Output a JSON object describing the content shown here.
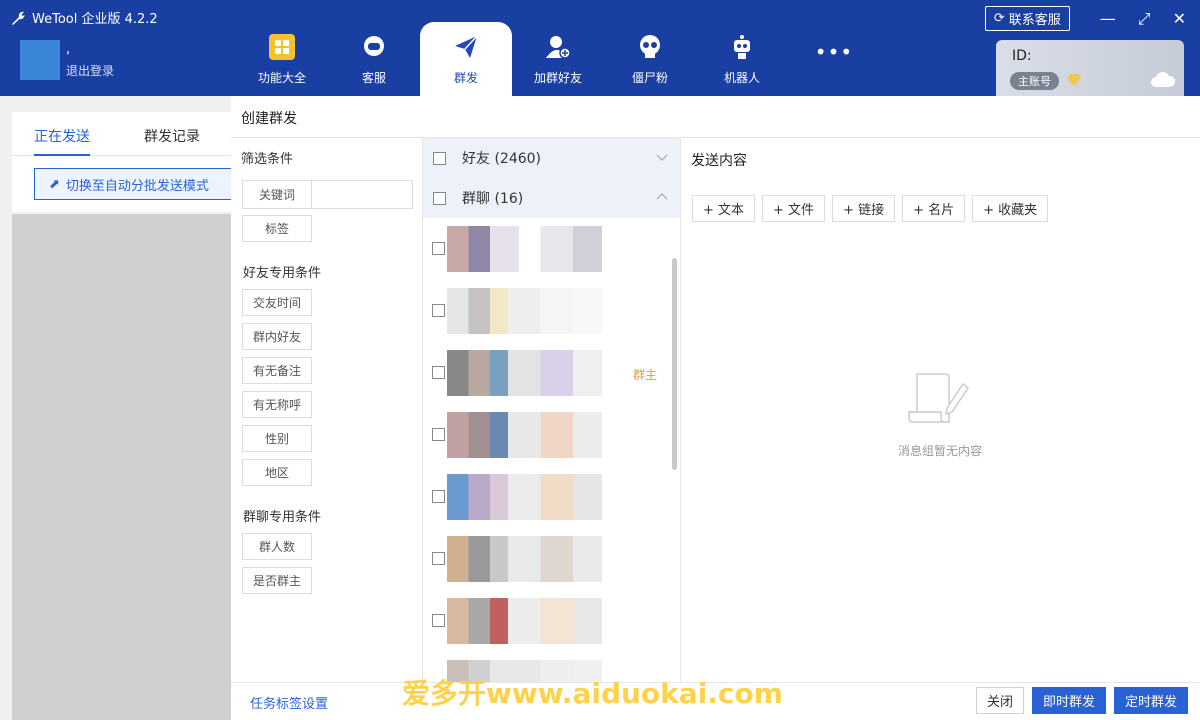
{
  "app": {
    "title": "WeTool 企业版 4.2.2",
    "contact_label": "联系客服"
  },
  "user": {
    "name": ",",
    "logout": "退出登录"
  },
  "nav": [
    {
      "label": "功能大全",
      "icon": "grid-icon"
    },
    {
      "label": "客服",
      "icon": "headset-icon"
    },
    {
      "label": "群发",
      "icon": "send-icon"
    },
    {
      "label": "加群好友",
      "icon": "add-user-icon"
    },
    {
      "label": "僵尸粉",
      "icon": "skull-icon"
    },
    {
      "label": "机器人",
      "icon": "robot-icon"
    },
    {
      "label": "",
      "icon": "more-icon"
    }
  ],
  "account": {
    "id_label": "ID:",
    "badge": "主账号"
  },
  "bg_panel": {
    "tab_sending": "正在发送",
    "tab_records": "群发记录",
    "switch_label": "切换至自动分批发送模式"
  },
  "dialog": {
    "title": "创建群发",
    "filter": {
      "title": "筛选条件",
      "keyword": "关键词",
      "tag": "标签",
      "friend_title": "好友专用条件",
      "friend_items": [
        "交友时间",
        "群内好友",
        "有无备注",
        "有无称呼",
        "性别",
        "地区"
      ],
      "group_title": "群聊专用条件",
      "group_items": [
        "群人数",
        "是否群主"
      ]
    },
    "list": {
      "friends_header": "好友 (2460)",
      "groups_header": "群聊 (16)",
      "owner_label": "群主"
    },
    "content": {
      "title": "发送内容",
      "add_buttons": [
        "+ 文本",
        "+ 文件",
        "+ 链接",
        "+ 名片",
        "+ 收藏夹"
      ],
      "empty_text": "消息组暂无内容"
    },
    "footer": {
      "task_link": "任务标签设置",
      "close": "关闭",
      "send_now": "即时群发",
      "send_scheduled": "定时群发"
    }
  },
  "watermark": "爱多开www.aiduokai.com",
  "colors": {
    "topbar": "#1a3fa3",
    "accent": "#2a62d6",
    "owner_label": "#d8a14a"
  }
}
